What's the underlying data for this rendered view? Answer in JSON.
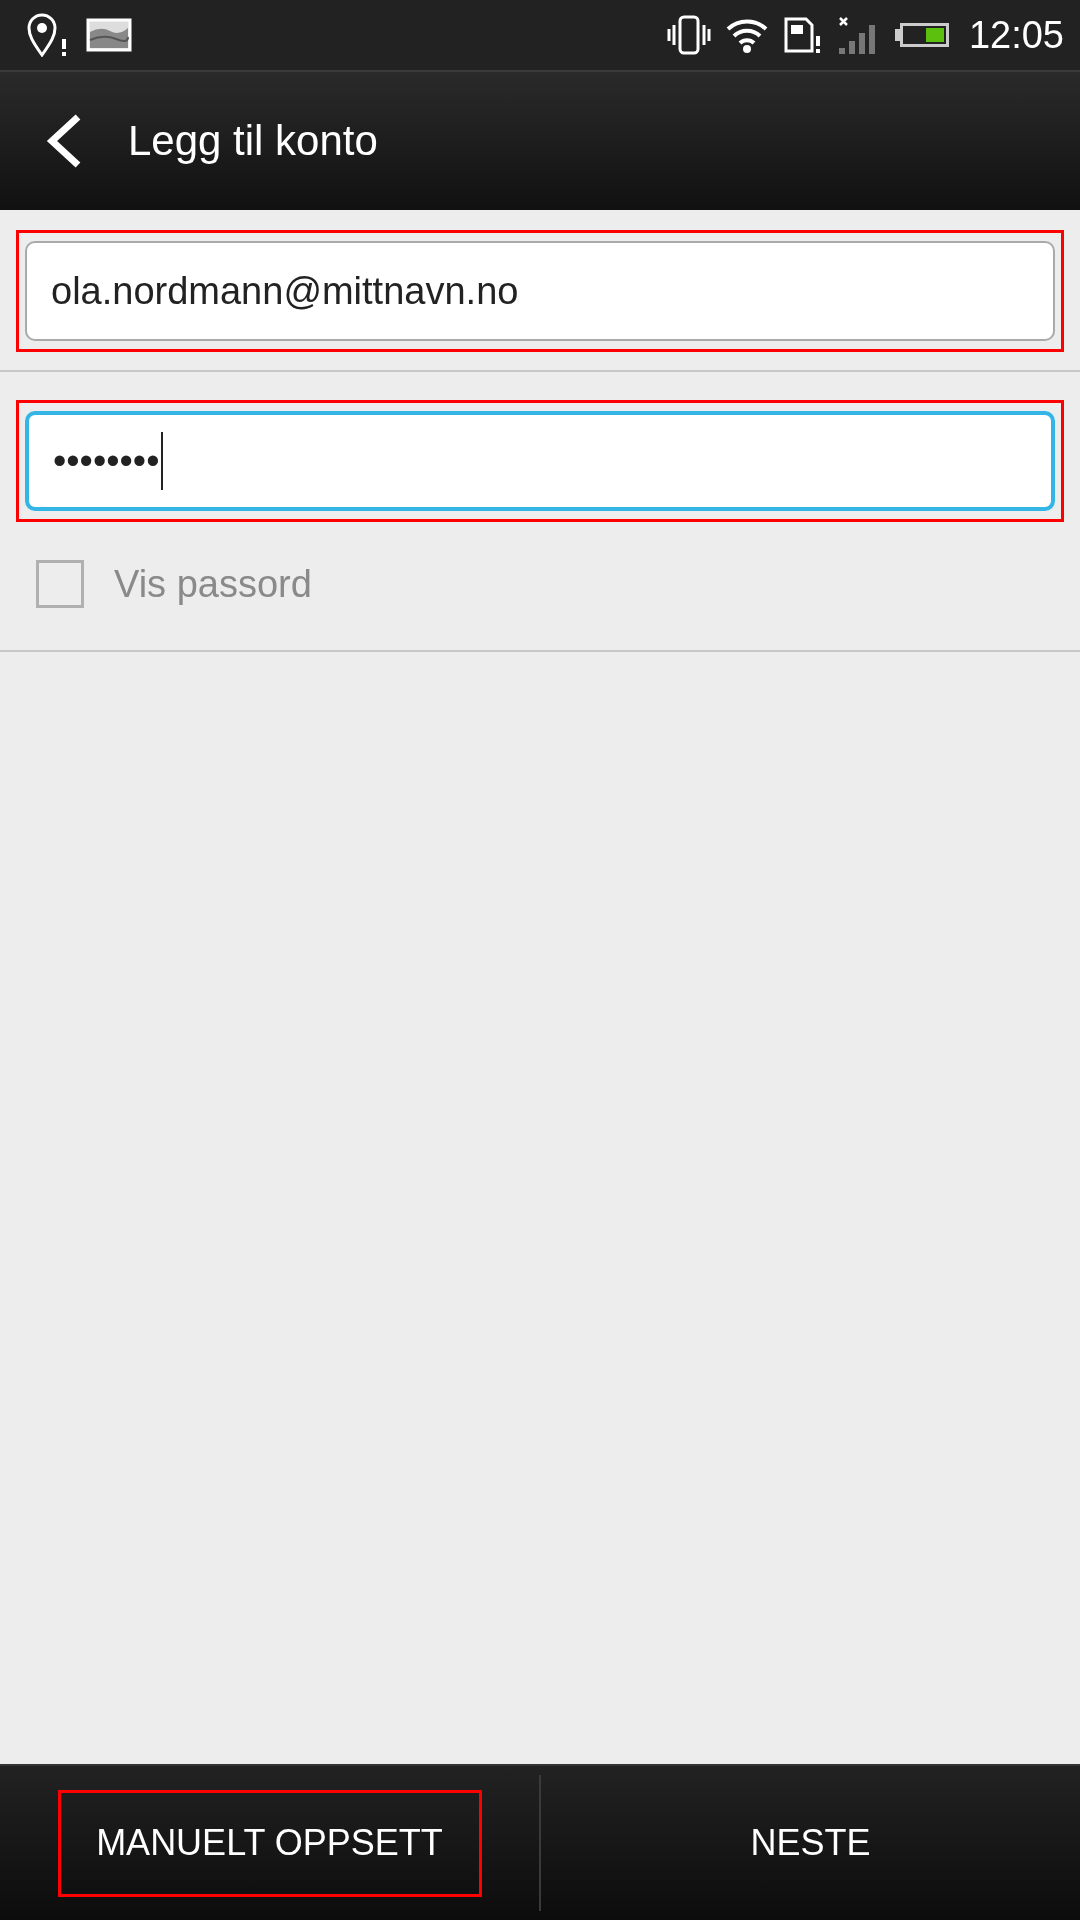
{
  "status_bar": {
    "time": "12:05"
  },
  "header": {
    "title": "Legg til konto"
  },
  "fields": [
    {
      "value": "ola.nordmann@mittnavn.no",
      "focused": false,
      "highlighted": true
    },
    {
      "value": "••••••••",
      "focused": true,
      "highlighted": true
    }
  ],
  "show_password": {
    "label": "Vis passord",
    "checked": false
  },
  "buttons": [
    {
      "label": "MANUELT OPPSETT",
      "highlighted": true
    },
    {
      "label": "NESTE",
      "highlighted": false
    }
  ]
}
